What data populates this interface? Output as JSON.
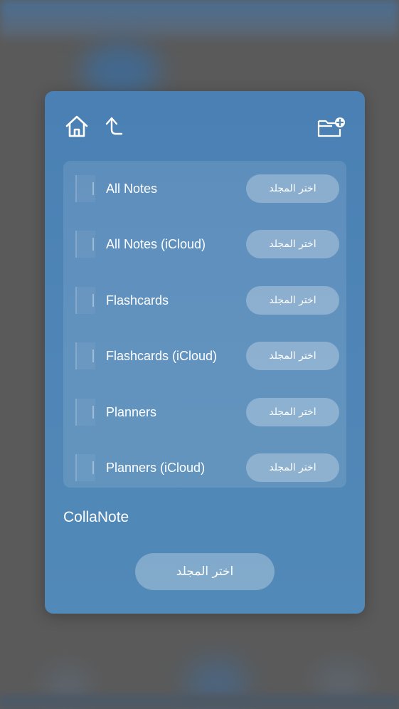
{
  "toolbar": {
    "home_icon": "home-icon",
    "up_icon": "arrow-up-icon",
    "new_folder_icon": "new-folder-icon"
  },
  "folders": [
    {
      "name": "All Notes",
      "action": "اختر المجلد"
    },
    {
      "name": "All Notes (iCloud)",
      "action": "اختر المجلد"
    },
    {
      "name": "Flashcards",
      "action": "اختر المجلد"
    },
    {
      "name": "Flashcards (iCloud)",
      "action": "اختر المجلد"
    },
    {
      "name": "Planners",
      "action": "اختر المجلد"
    },
    {
      "name": "Planners (iCloud)",
      "action": "اختر المجلد"
    }
  ],
  "current_folder": "CollaNote",
  "primary_action": "اختر المجلد",
  "colors": {
    "sheet": "#4f86b7",
    "text": "#ffffff"
  }
}
